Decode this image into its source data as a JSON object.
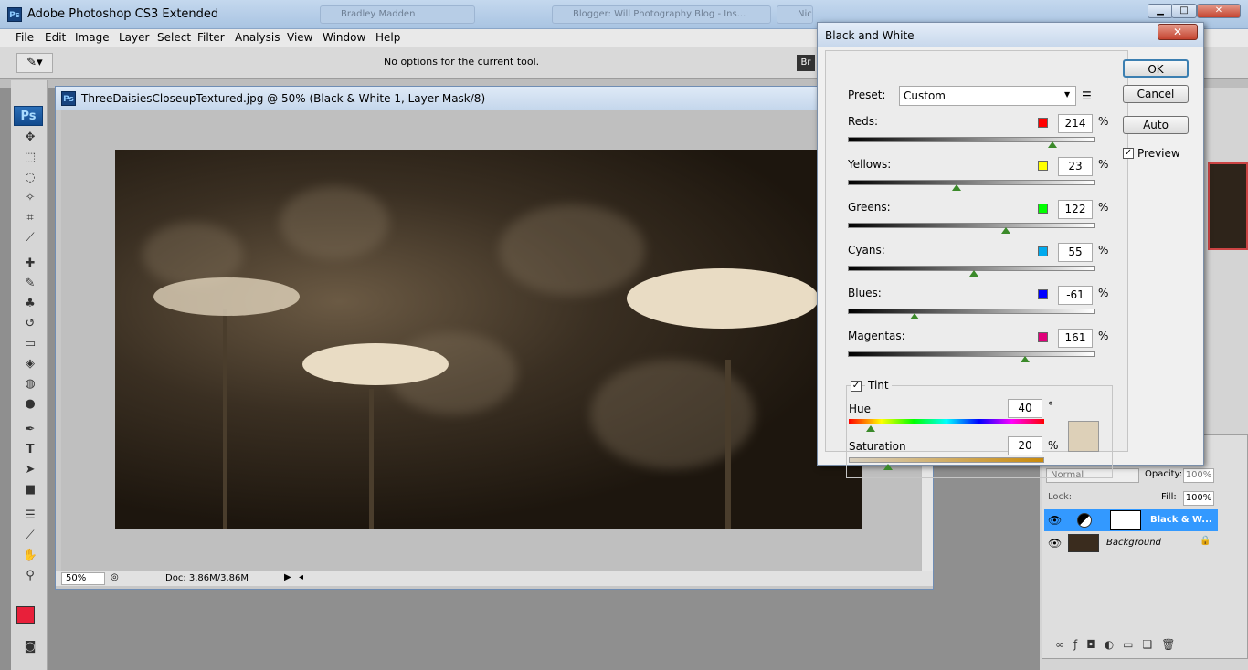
{
  "window": {
    "title": "Adobe Photoshop CS3 Extended",
    "bg_tabs": [
      "Bradley Madden",
      "Blogger: Will Photography Blog - Ins...",
      "Nice Flowers Street In The English"
    ]
  },
  "menu": [
    "File",
    "Edit",
    "Image",
    "Layer",
    "Select",
    "Filter",
    "Analysis",
    "View",
    "Window",
    "Help"
  ],
  "options": {
    "message": "No options for the current tool."
  },
  "document": {
    "title": "ThreeDaisiesCloseupTextured.jpg @ 50% (Black & White 1, Layer Mask/8)",
    "ps_badge": "Ps",
    "zoom": "50%",
    "doc_size": "Doc: 3.86M/3.86M"
  },
  "toolbox": {
    "logo": "Ps",
    "icons": [
      "move-icon",
      "marquee-icon",
      "lasso-icon",
      "magic-wand-icon",
      "crop-icon",
      "slice-icon",
      "healing-brush-icon",
      "brush-icon",
      "clone-stamp-icon",
      "history-brush-icon",
      "eraser-icon",
      "paint-bucket-icon",
      "blur-icon",
      "dodge-icon",
      "pen-icon",
      "type-icon",
      "path-selection-icon",
      "rectangle-icon",
      "notes-icon",
      "eyedropper-icon",
      "hand-icon",
      "zoom-icon"
    ],
    "foreground_color": "#e8203a",
    "background_color": "#ffffff"
  },
  "dialog": {
    "title": "Black and White",
    "close": "✕",
    "preset_label": "Preset:",
    "preset_value": "Custom",
    "channels": [
      {
        "label": "Reds:",
        "value": "214",
        "unit": "%",
        "color": "#ff0000",
        "level": 0.83
      },
      {
        "label": "Yellows:",
        "value": "23",
        "unit": "%",
        "color": "#ffff00",
        "level": 0.44
      },
      {
        "label": "Greens:",
        "value": "122",
        "unit": "%",
        "color": "#00ff00",
        "level": 0.64
      },
      {
        "label": "Cyans:",
        "value": "55",
        "unit": "%",
        "color": "#00aaee",
        "level": 0.51
      },
      {
        "label": "Blues:",
        "value": "-61",
        "unit": "%",
        "color": "#0000ff",
        "level": 0.27
      },
      {
        "label": "Magentas:",
        "value": "161",
        "unit": "%",
        "color": "#e0007a",
        "level": 0.72
      }
    ],
    "tint": {
      "label": "Tint",
      "hue_label": "Hue",
      "hue_value": "40",
      "hue_unit": "°",
      "hue_level": 0.11,
      "saturation_label": "Saturation",
      "saturation_value": "20",
      "saturation_unit": "%",
      "saturation_level": 0.2,
      "swatch_color": "#ddd0b8"
    },
    "buttons": {
      "ok": "OK",
      "cancel": "Cancel",
      "auto": "Auto"
    },
    "preview_label": "Preview"
  },
  "layers": {
    "blend_mode": "Normal",
    "opacity_label": "Opacity:",
    "opacity_value": "100%",
    "lock_label": "Lock:",
    "fill_label": "Fill:",
    "fill_value": "100%",
    "items": [
      {
        "name": "Black & W...",
        "selected": true
      },
      {
        "name": "Background",
        "selected": false
      }
    ]
  }
}
